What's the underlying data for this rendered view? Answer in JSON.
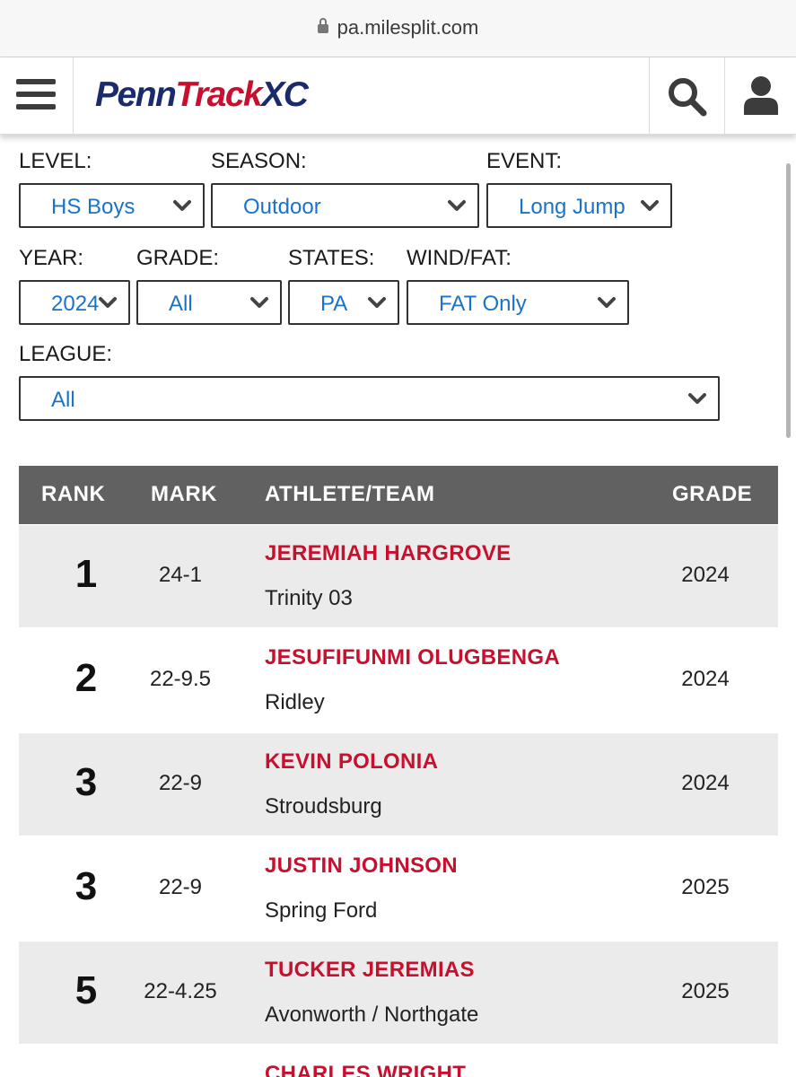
{
  "browser": {
    "url": "pa.milesplit.com"
  },
  "site": {
    "logo_part1": "Penn",
    "logo_part2": "Track",
    "logo_part3": "XC"
  },
  "filters": {
    "level": {
      "label": "LEVEL:",
      "value": "HS Boys"
    },
    "season": {
      "label": "SEASON:",
      "value": "Outdoor"
    },
    "event": {
      "label": "EVENT:",
      "value": "Long Jump"
    },
    "year": {
      "label": "YEAR:",
      "value": "2024"
    },
    "grade": {
      "label": "GRADE:",
      "value": "All"
    },
    "states": {
      "label": "STATES:",
      "value": "PA"
    },
    "wind": {
      "label": "WIND/FAT:",
      "value": "FAT Only"
    },
    "league": {
      "label": "LEAGUE:",
      "value": "All"
    }
  },
  "table": {
    "headers": {
      "rank": "RANK",
      "mark": "MARK",
      "athlete": "ATHLETE/TEAM",
      "grade": "GRADE"
    },
    "rows": [
      {
        "rank": "1",
        "mark": "24-1",
        "athlete": "JEREMIAH HARGROVE",
        "team": "Trinity 03",
        "grade": "2024"
      },
      {
        "rank": "2",
        "mark": "22-9.5",
        "athlete": "JESUFIFUNMI OLUGBENGA",
        "team": "Ridley",
        "grade": "2024"
      },
      {
        "rank": "3",
        "mark": "22-9",
        "athlete": "KEVIN POLONIA",
        "team": "Stroudsburg",
        "grade": "2024"
      },
      {
        "rank": "3",
        "mark": "22-9",
        "athlete": "JUSTIN JOHNSON",
        "team": "Spring Ford",
        "grade": "2025"
      },
      {
        "rank": "5",
        "mark": "22-4.25",
        "athlete": "TUCKER JEREMIAS",
        "team": "Avonworth / Northgate",
        "grade": "2025"
      },
      {
        "rank": "",
        "mark": "",
        "athlete": "CHARLES WRIGHT",
        "team": "",
        "grade": ""
      }
    ]
  },
  "colors": {
    "link_blue": "#1a73c9",
    "athlete_red": "#c8102e",
    "header_gray": "#616161",
    "row_shade": "#ebebeb",
    "logo_navy": "#1a2a6c"
  }
}
